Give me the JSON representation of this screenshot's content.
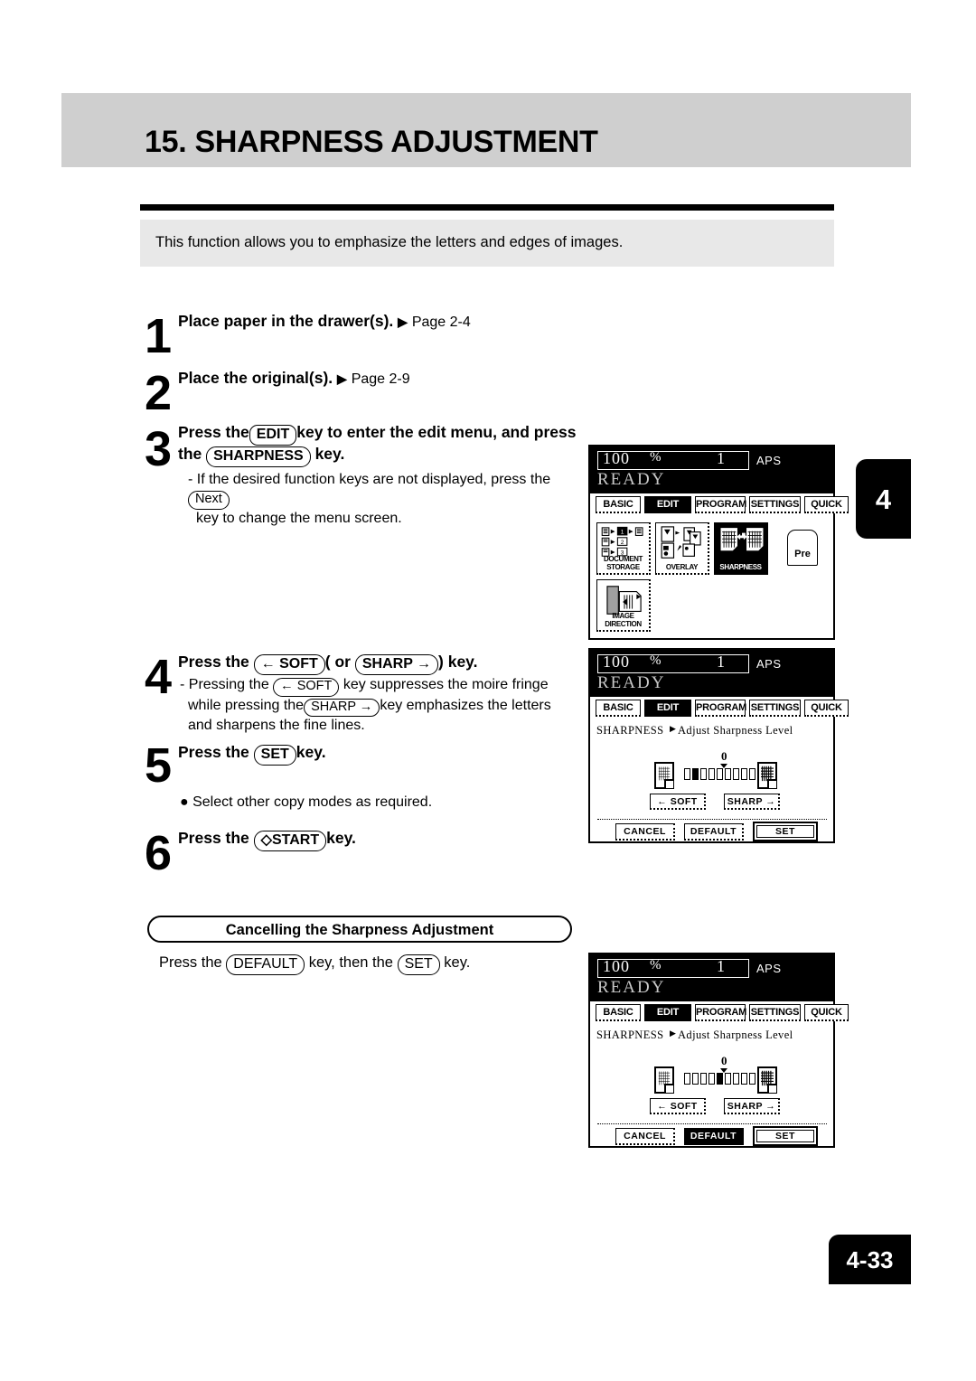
{
  "page": {
    "title": "15. SHARPNESS ADJUSTMENT",
    "intro": "This function allows you to emphasize the letters and edges of images.",
    "chapter_marker": "4",
    "page_number": "4-33"
  },
  "steps": [
    {
      "num": "1",
      "head_before": "Place paper in the drawer(s).",
      "arrow": "▶",
      "page_ref": "Page 2-4"
    },
    {
      "num": "2",
      "head_before": "Place the original(s).",
      "arrow": "▶",
      "page_ref": "Page 2-9"
    },
    {
      "num": "3",
      "line1_a": "Press the",
      "key_edit": "EDIT",
      "line1_b": "key to enter the edit menu, and  press",
      "line2_a": "the",
      "key_sharpness": "SHARPNESS",
      "line2_b": "key.",
      "sub_a": "-  If the desired function keys are not displayed, press the",
      "key_next": "Next",
      "sub_b": "key to change the menu screen."
    },
    {
      "num": "4",
      "head_a": "Press the",
      "key_soft": "← SOFT",
      "head_b": "( or",
      "key_sharp": "SHARP →",
      "head_c": ") key.",
      "sub_a": "-  Pressing the",
      "sub_key_soft": "← SOFT",
      "sub_b": "key suppresses the moire fringe",
      "sub_c": "while pressing the",
      "sub_key_sharp": "SHARP →",
      "sub_d": "key emphasizes the letters",
      "sub_e": "and sharpens the fine lines."
    },
    {
      "num": "5",
      "head_a": "Press the",
      "key_set": "SET",
      "head_b": "key.",
      "bullet": "●  Select other copy modes as required."
    },
    {
      "num": "6",
      "head_a": "Press the",
      "key_start": "◇START",
      "head_b": "key."
    }
  ],
  "cancelling": {
    "heading": "Cancelling the Sharpness Adjustment",
    "line_a": "Press the",
    "key_default": "DEFAULT",
    "line_b": "key, then the",
    "key_set": "SET",
    "line_c": "key."
  },
  "lcd_common": {
    "zoom_value": "100",
    "zoom_unit": "%",
    "copies": "1",
    "paper_mode": "APS",
    "status": "READY",
    "tabs": [
      {
        "label": "BASIC",
        "selected": false
      },
      {
        "label": "EDIT",
        "selected": true
      },
      {
        "label": "PROGRAM",
        "selected": false
      },
      {
        "label": "SETTINGS",
        "selected": false
      },
      {
        "label": "QUICK",
        "selected": false
      }
    ]
  },
  "lcd_edit_menu": {
    "tiles": [
      {
        "label": "DOCUMENT\nSTORAGE",
        "label_line1": "DOCUMENT",
        "label_line2": "STORAGE",
        "selected": false,
        "icon": "document-storage-icon"
      },
      {
        "label": "OVERLAY",
        "label_line1": "OVERLAY",
        "label_line2": "",
        "selected": false,
        "icon": "overlay-icon"
      },
      {
        "label": "SHARPNESS",
        "label_line1": "SHARPNESS",
        "label_line2": "",
        "selected": true,
        "icon": "sharpness-icon"
      },
      {
        "label": "IMAGE DIRECTION",
        "label_line1": "IMAGE DIRECTION",
        "label_line2": "",
        "selected": false,
        "icon": "image-direction-icon"
      }
    ],
    "prev_tab_label": "Pre"
  },
  "lcd_sharpness_adjust": {
    "function_name": "SHARPNESS",
    "instruction_arrow": "▶",
    "instruction": "Adjust Sharpness Level",
    "zero_label": "0",
    "slider_cell_count": 9,
    "slider_active_index": 2,
    "slider_zero_index": 5,
    "soft_button": "←  SOFT",
    "sharp_button": "SHARP →",
    "buttons": [
      {
        "label": "CANCEL",
        "selected": false,
        "emphasized": false
      },
      {
        "label": "DEFAULT",
        "selected": false,
        "emphasized": false
      },
      {
        "label": "SET",
        "selected": false,
        "emphasized": true
      }
    ]
  },
  "lcd_sharpness_default": {
    "function_name": "SHARPNESS",
    "instruction_arrow": "▶",
    "instruction": "Adjust Sharpness Level",
    "zero_label": "0",
    "slider_cell_count": 9,
    "slider_active_index": 5,
    "slider_zero_index": 5,
    "soft_button": "←  SOFT",
    "sharp_button": "SHARP →",
    "buttons": [
      {
        "label": "CANCEL",
        "selected": false,
        "emphasized": false
      },
      {
        "label": "DEFAULT",
        "selected": true,
        "emphasized": false
      },
      {
        "label": "SET",
        "selected": false,
        "emphasized": true
      }
    ]
  }
}
